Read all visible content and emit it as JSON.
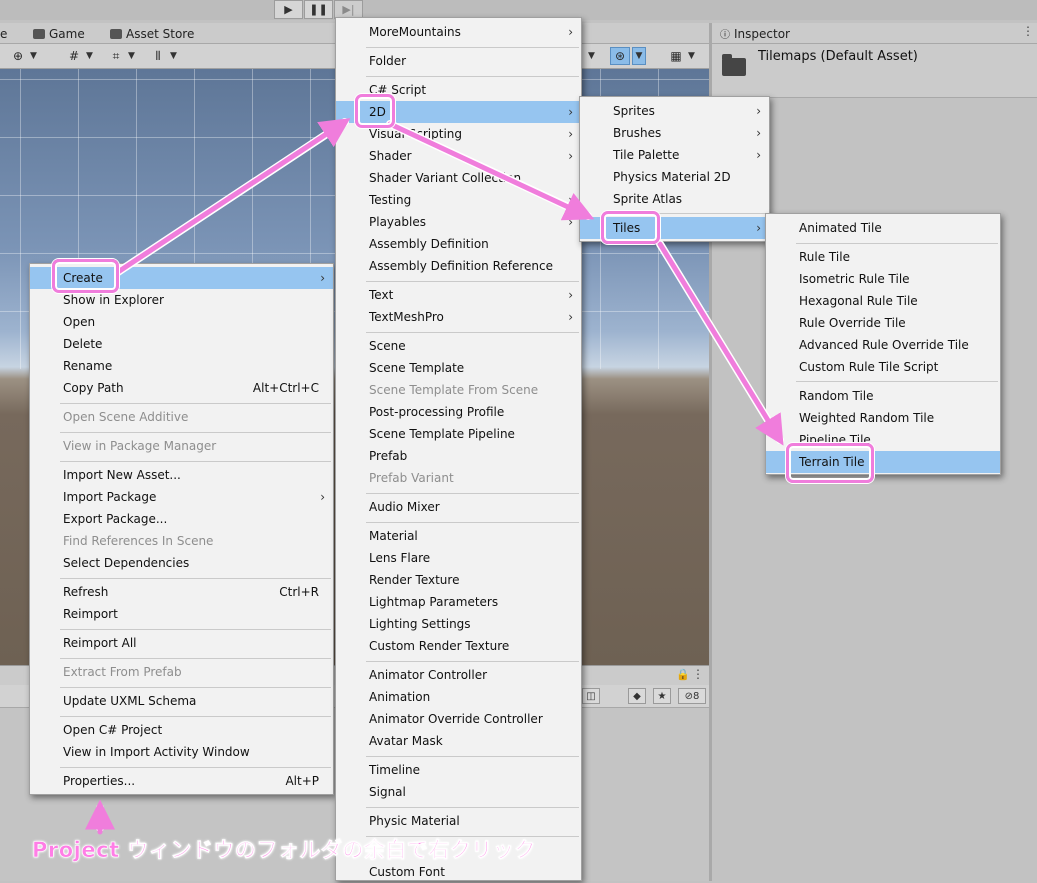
{
  "playbar": {
    "play_icon": "play-icon",
    "pause_icon": "pause-icon",
    "step_icon": "step-icon"
  },
  "scene_tabs": [
    {
      "label": "e"
    },
    {
      "label": "Game"
    },
    {
      "label": "Asset Store"
    }
  ],
  "inspector": {
    "tab_label": "Inspector",
    "asset_name": "Tilemaps (Default Asset)"
  },
  "project_toolbar": {
    "hidden_count": "8"
  },
  "context_menu": {
    "items": [
      {
        "label": "Create",
        "arrow": "›",
        "highlighted": true
      },
      {
        "label": "Show in Explorer"
      },
      {
        "label": "Open"
      },
      {
        "label": "Delete"
      },
      {
        "label": "Rename"
      },
      {
        "label": "Copy Path",
        "shortcut": "Alt+Ctrl+C"
      },
      {
        "label": "Open Scene Additive",
        "disabled": true
      },
      {
        "label": "View in Package Manager",
        "disabled": true
      },
      {
        "label": "Import New Asset..."
      },
      {
        "label": "Import Package",
        "arrow": "›"
      },
      {
        "label": "Export Package..."
      },
      {
        "label": "Find References In Scene",
        "disabled": true
      },
      {
        "label": "Select Dependencies"
      },
      {
        "label": "Refresh",
        "shortcut": "Ctrl+R"
      },
      {
        "label": "Reimport"
      },
      {
        "label": "Reimport All"
      },
      {
        "label": "Extract From Prefab",
        "disabled": true
      },
      {
        "label": "Update UXML Schema"
      },
      {
        "label": "Open C# Project"
      },
      {
        "label": "View in Import Activity Window"
      },
      {
        "label": "Properties...",
        "shortcut": "Alt+P"
      }
    ]
  },
  "create_menu": {
    "items": [
      {
        "label": "MoreMountains",
        "arrow": "›"
      },
      {
        "label": "Folder"
      },
      {
        "label": "C# Script"
      },
      {
        "label": "2D",
        "arrow": "›",
        "highlighted": true
      },
      {
        "label": "Visual Scripting",
        "arrow": "›"
      },
      {
        "label": "Shader",
        "arrow": "›"
      },
      {
        "label": "Shader Variant Collection"
      },
      {
        "label": "Testing",
        "arrow": "›"
      },
      {
        "label": "Playables",
        "arrow": "›"
      },
      {
        "label": "Assembly Definition"
      },
      {
        "label": "Assembly Definition Reference"
      },
      {
        "label": "Text",
        "arrow": "›"
      },
      {
        "label": "TextMeshPro",
        "arrow": "›"
      },
      {
        "label": "Scene"
      },
      {
        "label": "Scene Template"
      },
      {
        "label": "Scene Template From Scene",
        "disabled": true
      },
      {
        "label": "Post-processing Profile"
      },
      {
        "label": "Scene Template Pipeline"
      },
      {
        "label": "Prefab"
      },
      {
        "label": "Prefab Variant",
        "disabled": true
      },
      {
        "label": "Audio Mixer"
      },
      {
        "label": "Material"
      },
      {
        "label": "Lens Flare"
      },
      {
        "label": "Render Texture"
      },
      {
        "label": "Lightmap Parameters"
      },
      {
        "label": "Lighting Settings"
      },
      {
        "label": "Custom Render Texture"
      },
      {
        "label": "Animator Controller"
      },
      {
        "label": "Animation"
      },
      {
        "label": "Animator Override Controller"
      },
      {
        "label": "Avatar Mask"
      },
      {
        "label": "Timeline"
      },
      {
        "label": "Signal"
      },
      {
        "label": "Physic Material"
      },
      {
        "label": "Custom Font"
      }
    ]
  },
  "menu_2d": {
    "items": [
      {
        "label": "Sprites",
        "arrow": "›"
      },
      {
        "label": "Brushes",
        "arrow": "›"
      },
      {
        "label": "Tile Palette",
        "arrow": "›"
      },
      {
        "label": "Physics Material 2D"
      },
      {
        "label": "Sprite Atlas"
      },
      {
        "label": "Tiles",
        "arrow": "›",
        "highlighted": true
      }
    ]
  },
  "menu_tiles": {
    "items": [
      {
        "label": "Animated Tile"
      },
      {
        "label": "Rule Tile"
      },
      {
        "label": "Isometric Rule Tile"
      },
      {
        "label": "Hexagonal Rule Tile"
      },
      {
        "label": "Rule Override Tile"
      },
      {
        "label": "Advanced Rule Override Tile"
      },
      {
        "label": "Custom Rule Tile Script"
      },
      {
        "label": "Random Tile"
      },
      {
        "label": "Weighted Random Tile"
      },
      {
        "label": "Pipeline Tile"
      },
      {
        "label": "Terrain Tile",
        "highlighted": true
      }
    ]
  },
  "annotation": {
    "caption": "Project ウィンドウのフォルダの余白で右クリック",
    "color": "#f07ddc"
  }
}
